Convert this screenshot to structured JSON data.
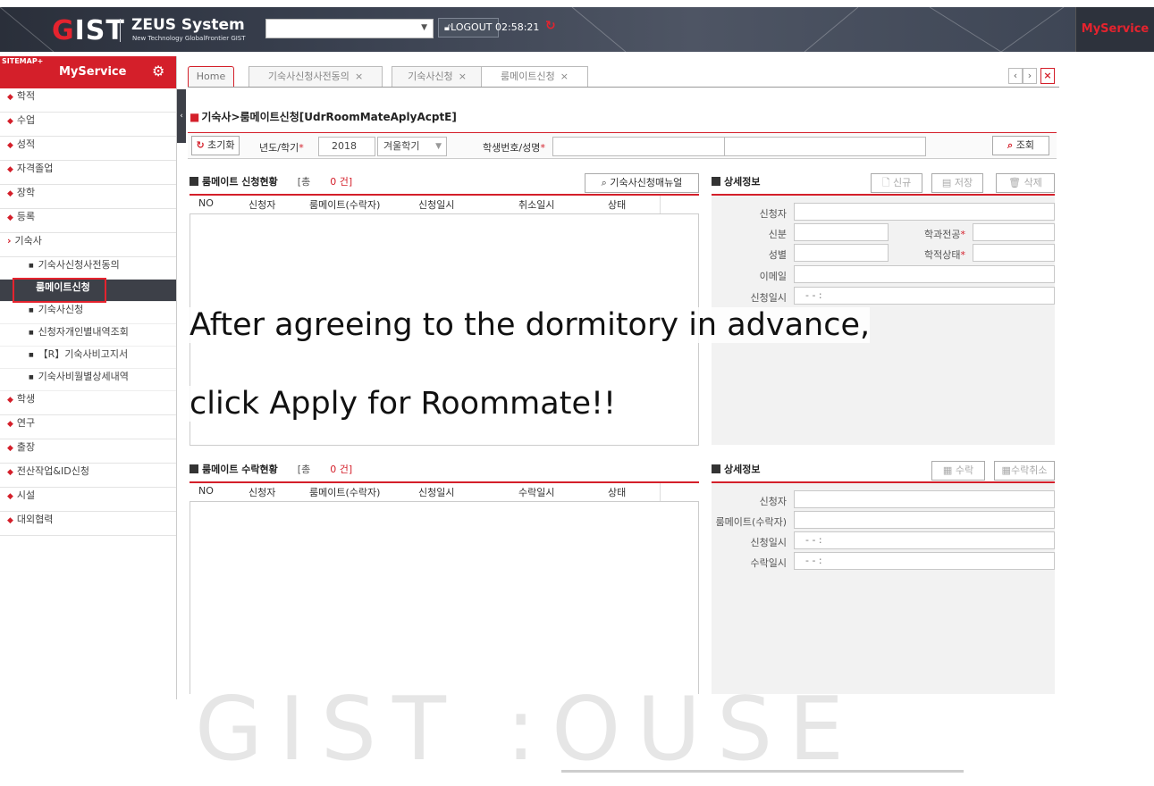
{
  "topbar": {
    "logo": "GIST",
    "system_name": "ZEUS System",
    "system_sub": "New Technology GlobalFrontier GIST",
    "logout_label": "LOGOUT",
    "timer": "02:58:21",
    "myservice_label": "MyService"
  },
  "sidebar": {
    "sitemap_label": "SITEMAP+",
    "title": "MyService",
    "items_top": [
      "학적",
      "수업",
      "성적",
      "자격졸업",
      "장학",
      "등록"
    ],
    "dorm_label": "기숙사",
    "dorm_sub": [
      "기숙사신청사전동의",
      "룸메이트신청",
      "기숙사신청",
      "신청자개인별내역조회",
      "【R】기숙사비고지서",
      "기숙사비월별상세내역"
    ],
    "items_bottom": [
      "학생",
      "연구",
      "출장",
      "전산작업&ID신청",
      "시설",
      "대외협력"
    ]
  },
  "tabs": {
    "home": "Home",
    "tab1": "기숙사신청사전동의",
    "tab2": "기숙사신청",
    "tab3": "룸메이트신청"
  },
  "page": {
    "title": "기숙사>룸메이트신청[UdrRoomMateAplyAcptE]",
    "reset_label": "초기화",
    "year_term_label": "년도/학기",
    "year_value": "2018",
    "term_value": "겨울학기",
    "student_label": "학생번호/성명",
    "search_label": "조회"
  },
  "request_panel": {
    "title": "룸메이트 신청현황",
    "count_prefix": "[총",
    "count_value": "0 건]",
    "manual_button": "기숙사신청매뉴얼",
    "columns": [
      "NO",
      "신청자",
      "룸메이트(수락자)",
      "신청일시",
      "취소일시",
      "상태"
    ]
  },
  "request_detail": {
    "title": "상세정보",
    "new_label": "신규",
    "save_label": "저장",
    "delete_label": "삭제",
    "applicant": "신청자",
    "status": "신분",
    "dept": "학과전공",
    "gender": "성별",
    "enroll": "학적상태",
    "email": "이메일",
    "apply_time": "신청일시",
    "apply_time_value": "- -   :"
  },
  "accept_panel": {
    "title": "룸메이트 수락현황",
    "count_prefix": "[총",
    "count_value": "0 건]",
    "columns": [
      "NO",
      "신청자",
      "룸메이트(수락자)",
      "신청일시",
      "수락일시",
      "상태"
    ]
  },
  "accept_detail": {
    "title": "상세정보",
    "accept_label": "수락",
    "cancel_label": "수락취소",
    "applicant": "신청자",
    "roommate": "룸메이트(수락자)",
    "apply_time": "신청일시",
    "accept_time": "수락일시",
    "time_value": "- -   :"
  },
  "overlay": {
    "line1": "After agreeing to the dormitory in advance,",
    "line2": "click Apply for Roommate!!"
  },
  "watermark": "GIST :OUSE",
  "colors": {
    "accent": "#d41f2a",
    "dark": "#3d4048"
  }
}
